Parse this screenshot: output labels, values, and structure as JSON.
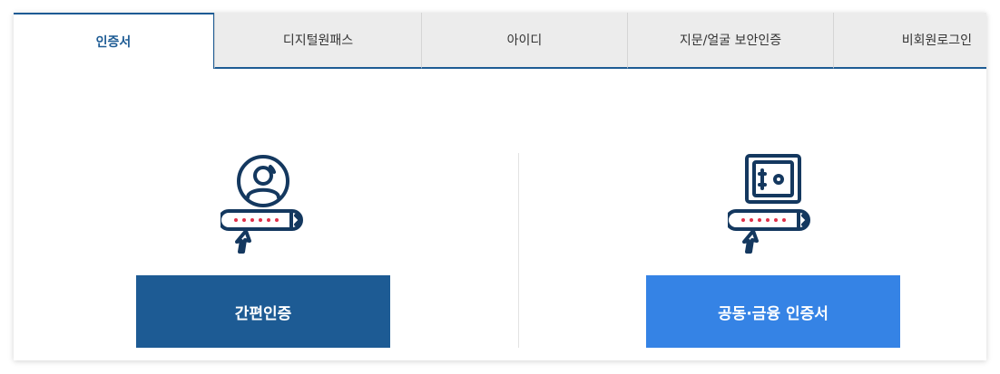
{
  "tabs": [
    {
      "label": "인증서",
      "active": true
    },
    {
      "label": "디지털원패스",
      "active": false
    },
    {
      "label": "아이디",
      "active": false
    },
    {
      "label": "지문/얼굴 보안인증",
      "active": false
    },
    {
      "label": "비회원로그인",
      "active": false
    }
  ],
  "login_options": {
    "simple_auth_label": "간편인증",
    "joint_financial_cert_label": "공동·금융 인증서"
  },
  "icons": {
    "simple_auth": "user-password-icon",
    "joint_cert": "safe-password-icon"
  },
  "colors": {
    "primary_dark": "#1d5b94",
    "primary_light": "#3583e5",
    "icon_navy": "#14385f",
    "password_dot": "#e0304a"
  }
}
